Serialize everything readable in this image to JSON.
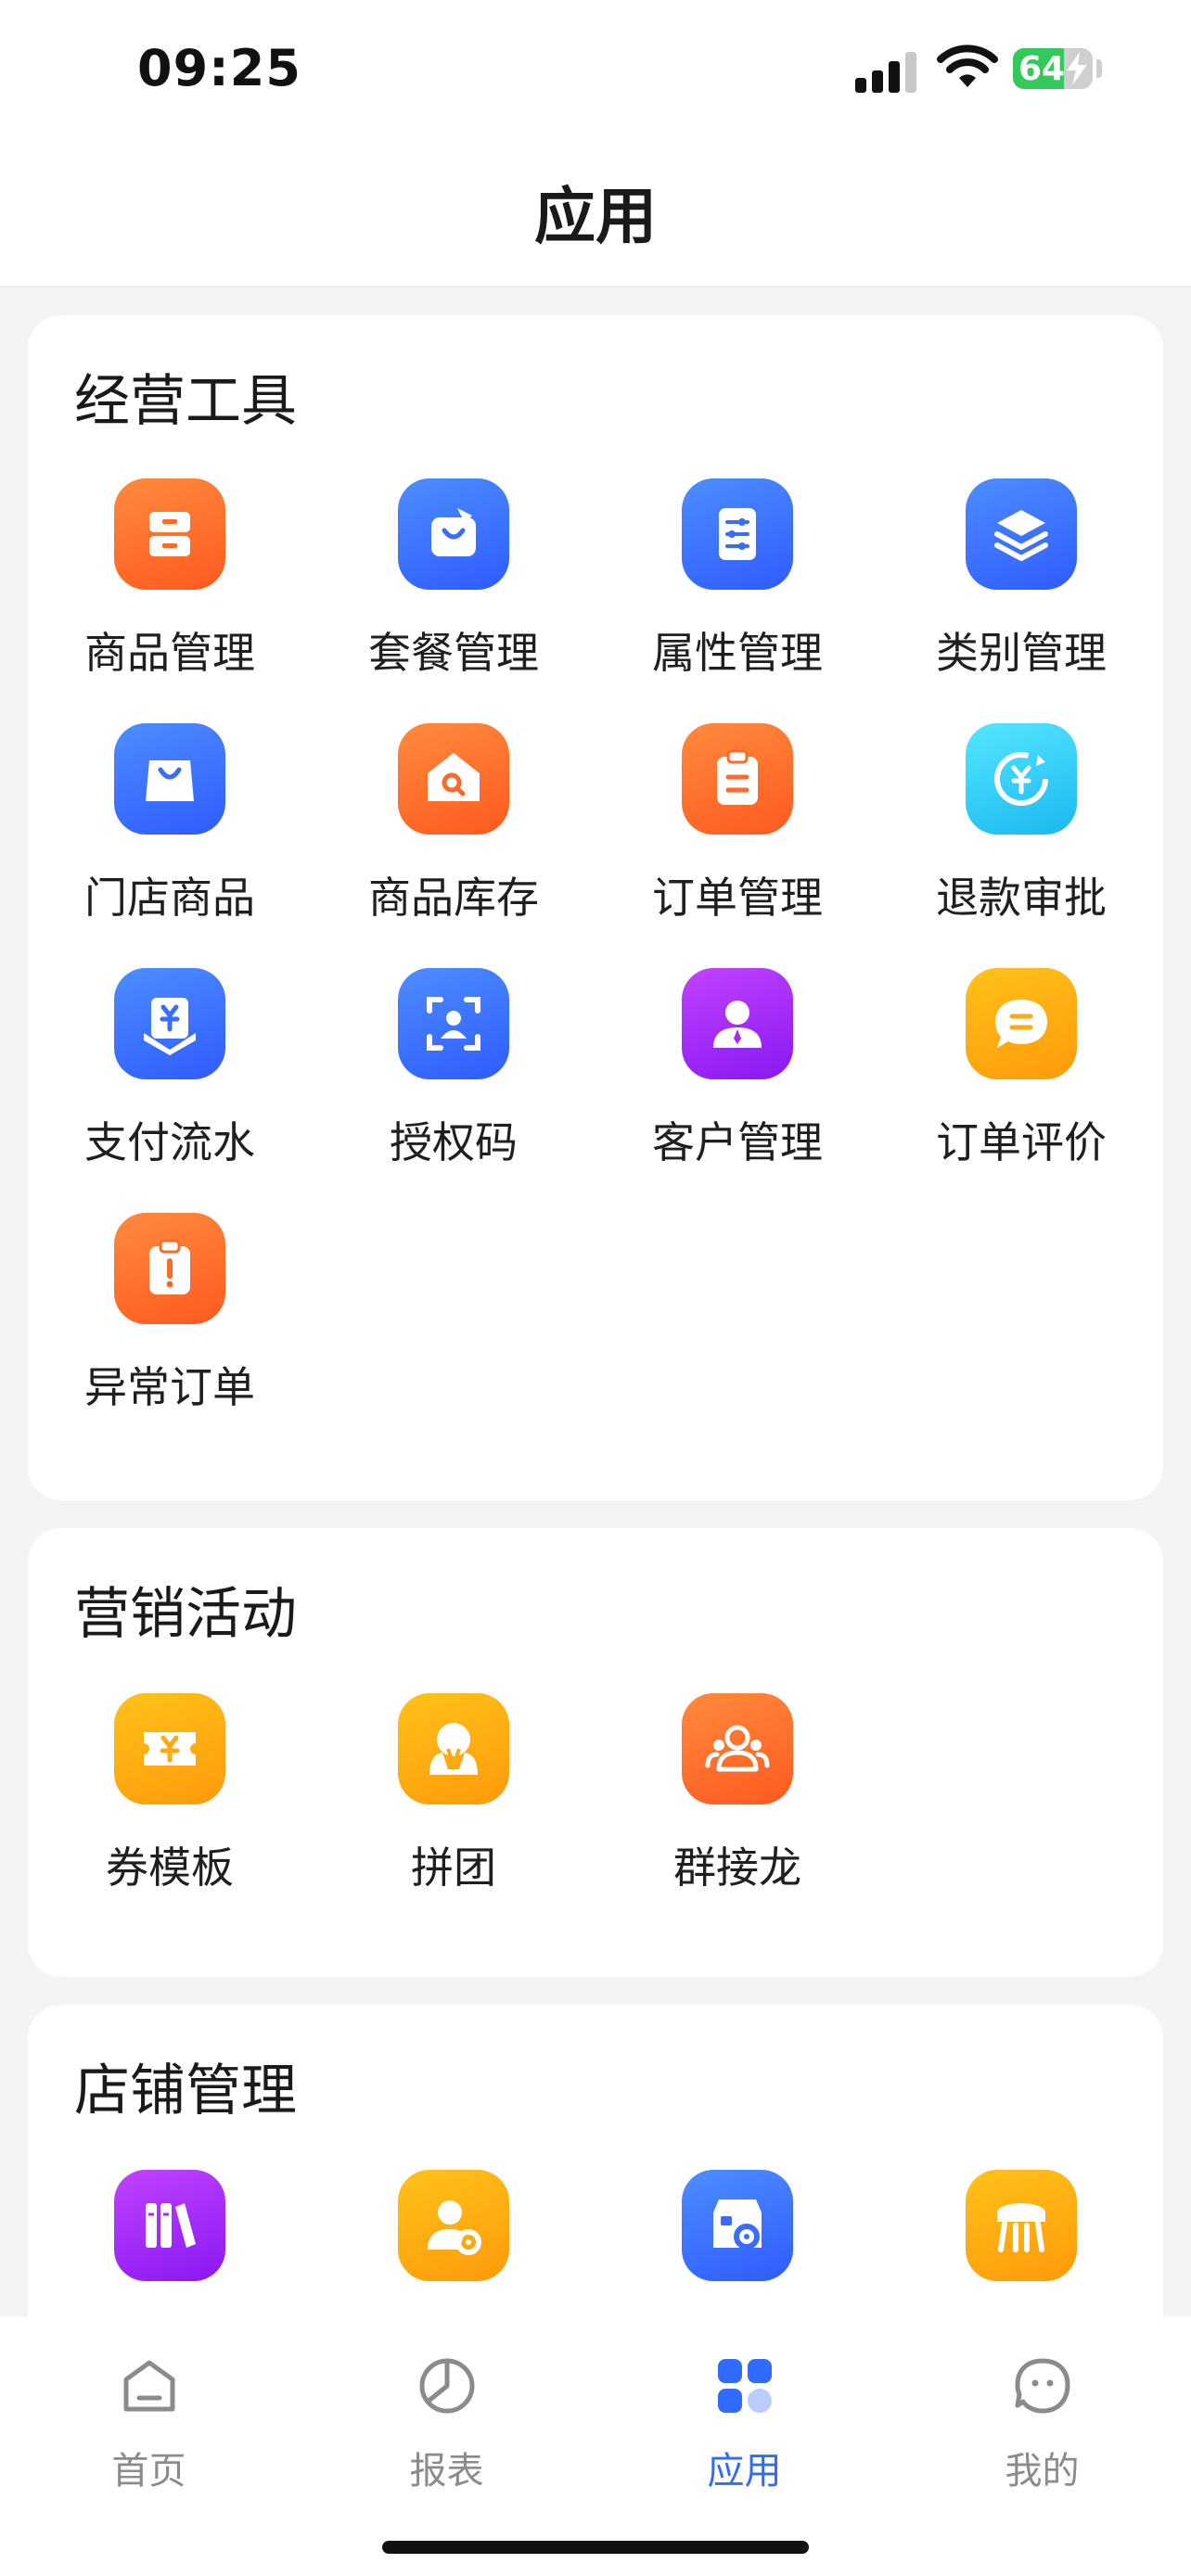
{
  "status_bar": {
    "time": "09:25",
    "battery_level": "64",
    "battery_fraction": 0.64
  },
  "nav": {
    "title": "应用"
  },
  "colors": {
    "accent": "#2f6bff",
    "orange": "#ff6a2b",
    "blue": "#3a6dff",
    "cyan": "#2ac8f5",
    "purple": "#a32df6",
    "yellow": "#ffaa12"
  },
  "sections": [
    {
      "title": "经营工具",
      "items": [
        {
          "label": "商品管理",
          "icon": "drawer-cabinet-icon",
          "color": "orange"
        },
        {
          "label": "套餐管理",
          "icon": "gift-box-icon",
          "color": "blue"
        },
        {
          "label": "属性管理",
          "icon": "sliders-document-icon",
          "color": "blue"
        },
        {
          "label": "类别管理",
          "icon": "layers-icon",
          "color": "blue"
        },
        {
          "label": "门店商品",
          "icon": "shopping-bag-icon",
          "color": "blue"
        },
        {
          "label": "商品库存",
          "icon": "house-search-icon",
          "color": "orange"
        },
        {
          "label": "订单管理",
          "icon": "clipboard-list-icon",
          "color": "orange"
        },
        {
          "label": "退款审批",
          "icon": "yen-refresh-icon",
          "color": "cyan"
        },
        {
          "label": "支付流水",
          "icon": "yen-download-icon",
          "color": "blue"
        },
        {
          "label": "授权码",
          "icon": "face-scan-icon",
          "color": "blue"
        },
        {
          "label": "客户管理",
          "icon": "customer-person-icon",
          "color": "purple"
        },
        {
          "label": "订单评价",
          "icon": "chat-bubble-icon",
          "color": "yellow"
        },
        {
          "label": "异常订单",
          "icon": "clipboard-alert-icon",
          "color": "orange"
        }
      ]
    },
    {
      "title": "营销活动",
      "items": [
        {
          "label": "券模板",
          "icon": "yen-coupon-icon",
          "color": "yellow"
        },
        {
          "label": "拼团",
          "icon": "group-buy-icon",
          "color": "yellow"
        },
        {
          "label": "群接龙",
          "icon": "group-people-icon",
          "color": "orange"
        }
      ]
    },
    {
      "title": "店铺管理",
      "items": [
        {
          "label": "",
          "icon": "books-icon",
          "color": "purple"
        },
        {
          "label": "",
          "icon": "staff-settings-icon",
          "color": "yellow"
        },
        {
          "label": "",
          "icon": "store-settings-icon",
          "color": "blue"
        },
        {
          "label": "",
          "icon": "table-icon",
          "color": "yellow"
        }
      ]
    }
  ],
  "tabs": [
    {
      "label": "首页",
      "icon": "home-icon",
      "active": false
    },
    {
      "label": "报表",
      "icon": "pie-chart-icon",
      "active": false
    },
    {
      "label": "应用",
      "icon": "apps-grid-icon",
      "active": true
    },
    {
      "label": "我的",
      "icon": "profile-face-icon",
      "active": false
    }
  ]
}
